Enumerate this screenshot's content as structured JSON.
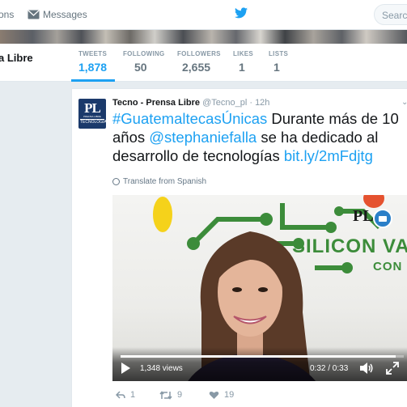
{
  "nav": {
    "notifications_label": "ons",
    "messages_label": "Messages",
    "search_placeholder": "Search"
  },
  "profile": {
    "name": "a Libre",
    "stats": [
      {
        "label": "TWEETS",
        "value": "1,878",
        "active": true
      },
      {
        "label": "FOLLOWING",
        "value": "50",
        "active": false
      },
      {
        "label": "FOLLOWERS",
        "value": "2,655",
        "active": false
      },
      {
        "label": "LIKES",
        "value": "1",
        "active": false
      },
      {
        "label": "LISTS",
        "value": "1",
        "active": false
      }
    ]
  },
  "tweet": {
    "avatar": {
      "initials": "PL",
      "line1": "PRENSA LIBRE",
      "line2": "TECNOLOGÍA"
    },
    "author": "Tecno - Prensa Libre",
    "handle": "@Tecno_pl",
    "dot": "·",
    "time": "12h",
    "text": {
      "hashtag": "#GuatemaltecasÚnicas",
      "part1": " Durante más de 10 años ",
      "mention": "@stephaniefalla",
      "part2": " se ha dedicado al desarrollo de tecnologías ",
      "url": "bit.ly/2mFdjtg"
    },
    "translate_label": "Translate from Spanish",
    "video": {
      "views": "1,348 views",
      "time": "0:32 / 0:33",
      "progress": 0.97,
      "wall_text_1": "SILICON VAL",
      "wall_text_2": "CON F",
      "logo_text": "PL"
    },
    "actions": {
      "replies": "1",
      "retweets": "9",
      "likes": "19"
    },
    "colors": {
      "link": "#1da1f2",
      "green": "#3c8c3a"
    }
  }
}
